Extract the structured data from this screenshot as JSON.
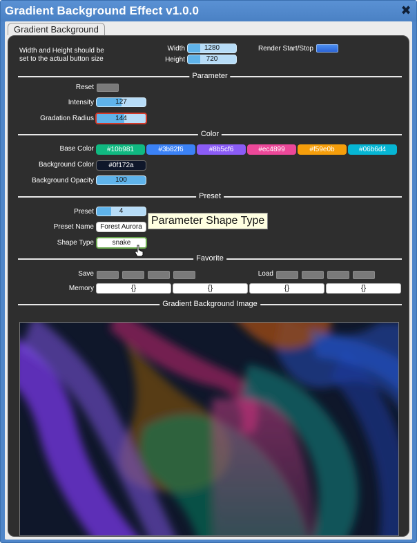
{
  "window": {
    "title": "Gradient Background Effect v1.0.0",
    "close_glyph": "✖"
  },
  "tab": {
    "label": "Gradient Background"
  },
  "header": {
    "note_line1": "Width and Height should be",
    "note_line2": "set to the actual button size",
    "width_label": "Width",
    "width_value": "1280",
    "width_fraction": 0.25,
    "height_label": "Height",
    "height_value": "720",
    "height_fraction": 0.25,
    "render_label": "Render Start/Stop"
  },
  "sections": {
    "parameter": "Parameter",
    "color": "Color",
    "preset": "Preset",
    "favorite": "Favorite",
    "image": "Gradient Background Image"
  },
  "parameter": {
    "reset_label": "Reset",
    "intensity_label": "Intensity",
    "intensity_value": "127",
    "intensity_fraction": 0.5,
    "radius_label": "Gradation Radius",
    "radius_value": "144",
    "radius_fraction": 0.57
  },
  "color": {
    "base_label": "Base Color",
    "base_colors": [
      {
        "text": "#10b981",
        "bg": "#10b981"
      },
      {
        "text": "#3b82f6",
        "bg": "#3b82f6"
      },
      {
        "text": "#8b5cf6",
        "bg": "#8b5cf6"
      },
      {
        "text": "#ec4899",
        "bg": "#ec4899"
      },
      {
        "text": "#f59e0b",
        "bg": "#f59e0b"
      },
      {
        "text": "#06b6d4",
        "bg": "#06b6d4"
      }
    ],
    "background_label": "Background Color",
    "background_value": "#0f172a",
    "opacity_label": "Background Opacity",
    "opacity_value": "100",
    "opacity_fraction": 1.0
  },
  "preset": {
    "preset_label": "Preset",
    "preset_value": "4",
    "preset_fraction": 0.3,
    "name_label": "Preset Name",
    "name_value": "Forest Aurora",
    "shape_label": "Shape Type",
    "shape_value": "snake",
    "tooltip": "Parameter Shape Type"
  },
  "favorite": {
    "save_label": "Save",
    "load_label": "Load",
    "memory": [
      "{}",
      "{}",
      "{}",
      "{}"
    ]
  }
}
